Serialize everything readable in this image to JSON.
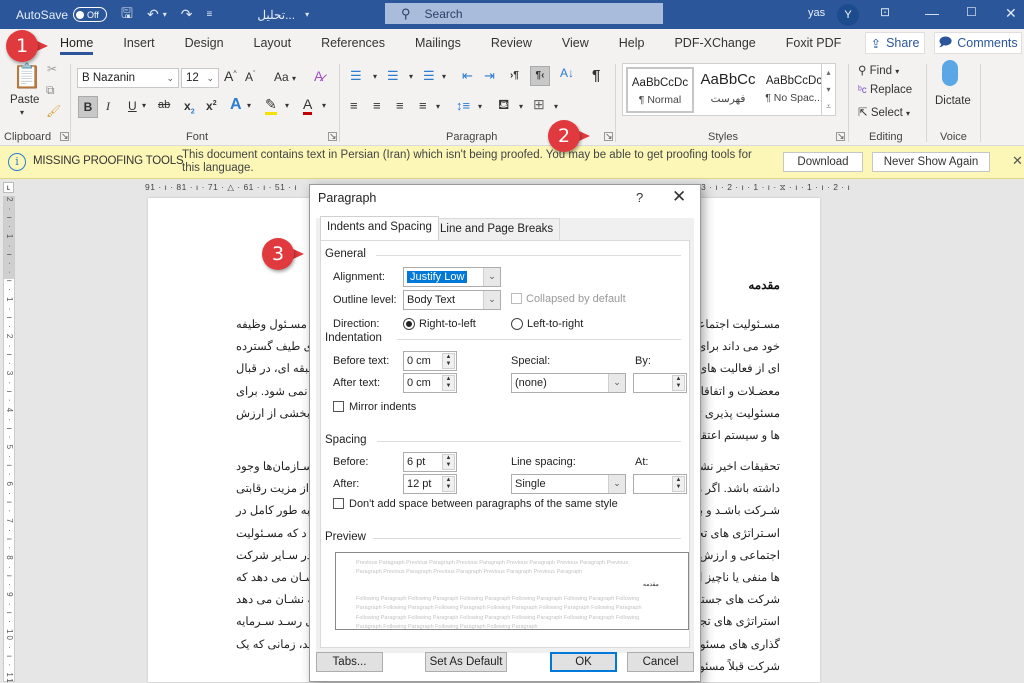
{
  "titlebar": {
    "autosave_label": "AutoSave",
    "autosave_state": "Off",
    "doc_title": "تحلیل...",
    "search_placeholder": "Search",
    "user_name": "yas",
    "user_initial": "Y",
    "icons": [
      "save-icon",
      "undo-icon",
      "redo-icon",
      "customize-qat-icon",
      "ribbon-display-icon",
      "minimize-icon",
      "maximize-icon",
      "close-icon"
    ]
  },
  "tabs": [
    "Home",
    "Insert",
    "Design",
    "Layout",
    "References",
    "Mailings",
    "Review",
    "View",
    "Help",
    "PDF-XChange",
    "Foxit PDF"
  ],
  "active_tab": "Home",
  "share_label": "Share",
  "comments_label": "Comments",
  "ribbon": {
    "clipboard": {
      "paste_label": "Paste",
      "group_label": "Clipboard"
    },
    "font": {
      "font_name": "B Nazanin",
      "font_size": "12",
      "group_label": "Font",
      "change_case": "Aa"
    },
    "paragraph": {
      "group_label": "Paragraph"
    },
    "styles": {
      "group_label": "Styles",
      "items": [
        {
          "sample": "AaBbCcDc",
          "name": "¶ Normal"
        },
        {
          "sample": "AaBbCc",
          "name": "فهرست"
        },
        {
          "sample": "AaBbCcDc",
          "name": "¶ No Spac..."
        }
      ]
    },
    "editing": {
      "find": "Find",
      "replace": "Replace",
      "select": "Select",
      "group_label": "Editing"
    },
    "voice": {
      "dictate": "Dictate",
      "group_label": "Voice"
    }
  },
  "infobar": {
    "title": "MISSING PROOFING TOOLS",
    "message": "This document contains text in Persian (Iran) which isn't being proofed. You may be able to get proofing tools for this language.",
    "download": "Download",
    "never_show": "Never Show Again"
  },
  "ruler": {
    "left_marks": "91 · ı · 81 · ı · 71 · △ · 61 · ı · 51 · ı",
    "right_marks": "3 · ı · 2 · ı · 1 · ı · ⧖ · ı · 1 · ı · 2 · ı",
    "vertical_marks": "2 · ı · 1 · ı · · ı · 1 · ı · 2 · ı · 3 · ı · 4 · ı · 5 · ı · 6 · ı · 7 · ı · 8 · ı · 9 · ı · 10 · ı · 11 · ı"
  },
  "document": {
    "heading": "مقدمه",
    "para1_right": [
      "مسـئولیت اجتماعی در",
      "خود می داند برای رفع آ",
      "ای از فعالیت های فرهنگ",
      "معضـلات و اتفاقاتی که",
      "مسئولیت پذیری تنها ش",
      "ها و سیستم اعتقادی و"
    ],
    "para1_left": [
      "د مسـئول وظیفه",
      "ی طیف گسترده",
      "طبقه ای، در قبال",
      "د نمی شود. برای",
      "و بخشی از ارزش",
      ""
    ],
    "para2_right": [
      "تحقیقات اخیر نشان می",
      "داشته باشد. اگر مسئولی",
      "شـرکت باشـد و بر بهره",
      "اسـتراتژی های تجاری",
      "اجتماعی و ارزش شرکت",
      "ها منفی یا ناچیز است.",
      "شرکت های جستجوگر",
      "استراتژی های تجاری ب",
      "گذاری های مسئولیت ا",
      "شرکت قبلاً مسئولیت ه"
    ],
    "para2_left": [
      "سـازمان‌ها وجود",
      "ی از مزیت رقابتی",
      "ا به طور کامل در",
      "د که مسـئولیت",
      "ه در سـایر شرکت",
      "شـان می دهد که",
      "که نشـان می دهد",
      "ی رسـد سـرمایه",
      "سد، زمانی که یک",
      ""
    ]
  },
  "dialog": {
    "title": "Paragraph",
    "help": "?",
    "tabs": [
      "Indents and Spacing",
      "Line and Page Breaks"
    ],
    "general": {
      "section": "General",
      "alignment_label": "Alignment:",
      "alignment_value": "Justify Low",
      "outline_label": "Outline level:",
      "outline_value": "Body Text",
      "collapsed_label": "Collapsed by default",
      "direction_label": "Direction:",
      "rtl_label": "Right-to-left",
      "ltr_label": "Left-to-right",
      "direction_selected": "Right-to-left"
    },
    "indentation": {
      "section": "Indentation",
      "before_label": "Before text:",
      "before_value": "0 cm",
      "after_label": "After text:",
      "after_value": "0 cm",
      "special_label": "Special:",
      "special_value": "(none)",
      "by_label": "By:",
      "by_value": "",
      "mirror_label": "Mirror indents",
      "mirror_checked": false
    },
    "spacing": {
      "section": "Spacing",
      "before_label": "Before:",
      "before_value": "6 pt",
      "after_label": "After:",
      "after_value": "12 pt",
      "line_label": "Line spacing:",
      "line_value": "Single",
      "at_label": "At:",
      "at_value": "",
      "dont_add_label": "Don't add space between paragraphs of the same style",
      "dont_add_checked": false
    },
    "preview": {
      "section": "Preview",
      "previous": "Previous Paragraph Previous Paragraph Previous Paragraph Previous Paragraph Previous Paragraph Previous Paragraph Previous Paragraph Previous Paragraph Previous Paragraph Previous Paragraph",
      "sample": "مقدمه",
      "following": "Following Paragraph Following Paragraph Following Paragraph Following Paragraph Following Paragraph Following Paragraph Following Paragraph Following Paragraph Following Paragraph Following Paragraph Following Paragraph Following Paragraph Following Paragraph Following Paragraph Following Paragraph Following Paragraph Following Paragraph Following Paragraph Following Paragraph Following Paragraph"
    },
    "buttons": {
      "tabs": "Tabs...",
      "set_default": "Set As Default",
      "ok": "OK",
      "cancel": "Cancel"
    }
  },
  "callouts": [
    "1",
    "2",
    "3"
  ],
  "colors": {
    "accent": "#2b579a",
    "callout": "#e0393e",
    "infobar": "#fcf7b6",
    "selection": "#0078d7"
  }
}
